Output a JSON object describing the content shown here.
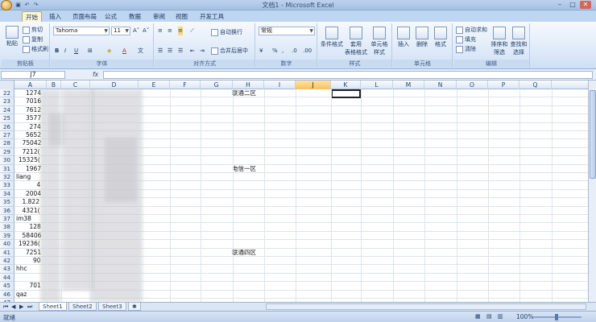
{
  "window": {
    "title": "文档1 - Microsoft Excel"
  },
  "tabs": [
    {
      "label": "开始",
      "active": true
    },
    {
      "label": "插入"
    },
    {
      "label": "页面布局"
    },
    {
      "label": "公式"
    },
    {
      "label": "数据"
    },
    {
      "label": "审阅"
    },
    {
      "label": "视图"
    },
    {
      "label": "开发工具"
    }
  ],
  "ribbon": {
    "clipboard": {
      "paste": "粘贴",
      "cut": "剪切",
      "copy": "复制",
      "format_painter": "格式刷",
      "label": "剪贴板"
    },
    "font": {
      "name": "Tahoma",
      "size": "11",
      "label": "字体"
    },
    "alignment": {
      "wrap": "自动换行",
      "merge": "合并后居中",
      "label": "对齐方式"
    },
    "number": {
      "format": "常规",
      "label": "数字"
    },
    "styles": {
      "conditional": "条件格式",
      "table": "套用\n表格格式",
      "cell": "单元格\n样式",
      "label": "样式"
    },
    "cells": {
      "insert": "插入",
      "delete": "删除",
      "format": "格式",
      "label": "单元格"
    },
    "editing": {
      "autosum": "自动求和",
      "fill": "填充",
      "clear": "清除",
      "sort": "排序和\n筛选",
      "find": "查找和\n选择",
      "label": "编辑"
    }
  },
  "formula_bar": {
    "name_box": "J7",
    "fx": "fx",
    "value": ""
  },
  "columns": [
    "A",
    "B",
    "C",
    "D",
    "E",
    "F",
    "G",
    "H",
    "I",
    "J",
    "K",
    "L",
    "M",
    "N",
    "O",
    "P",
    "Q"
  ],
  "selected_column": "J",
  "rows": [
    {
      "n": "22",
      "a": "1274"
    },
    {
      "n": "23",
      "a": "7016"
    },
    {
      "n": "24",
      "a": "7612"
    },
    {
      "n": "25",
      "a": "3577"
    },
    {
      "n": "26",
      "a": "274"
    },
    {
      "n": "27",
      "a": "5652"
    },
    {
      "n": "28",
      "a": "75042"
    },
    {
      "n": "29",
      "a": "7212("
    },
    {
      "n": "30",
      "a": "15325("
    },
    {
      "n": "31",
      "a": "1967"
    },
    {
      "n": "32",
      "a": "liang"
    },
    {
      "n": "33",
      "a": "4"
    },
    {
      "n": "34",
      "a": "2004"
    },
    {
      "n": "35",
      "a": "1.822"
    },
    {
      "n": "36",
      "a": "4321("
    },
    {
      "n": "37",
      "a": "im38"
    },
    {
      "n": "38",
      "a": "128"
    },
    {
      "n": "39",
      "a": "58406"
    },
    {
      "n": "40",
      "a": "19236("
    },
    {
      "n": "41",
      "a": "7251"
    },
    {
      "n": "42",
      "a": "90"
    },
    {
      "n": "43",
      "a": "hhc"
    },
    {
      "n": "44",
      "a": ""
    },
    {
      "n": "45",
      "a": "701"
    },
    {
      "n": "46",
      "a": "qaz"
    },
    {
      "n": "47",
      "a": ""
    }
  ],
  "g_labels": [
    {
      "row": "22",
      "text": "联通二区"
    },
    {
      "row": "31",
      "text": "电信一区"
    },
    {
      "row": "41",
      "text": "联通四区"
    }
  ],
  "sheets": [
    {
      "label": "Sheet1",
      "active": true
    },
    {
      "label": "Sheet2"
    },
    {
      "label": "Sheet3"
    }
  ],
  "status": {
    "ready": "就绪",
    "zoom": "100%"
  }
}
